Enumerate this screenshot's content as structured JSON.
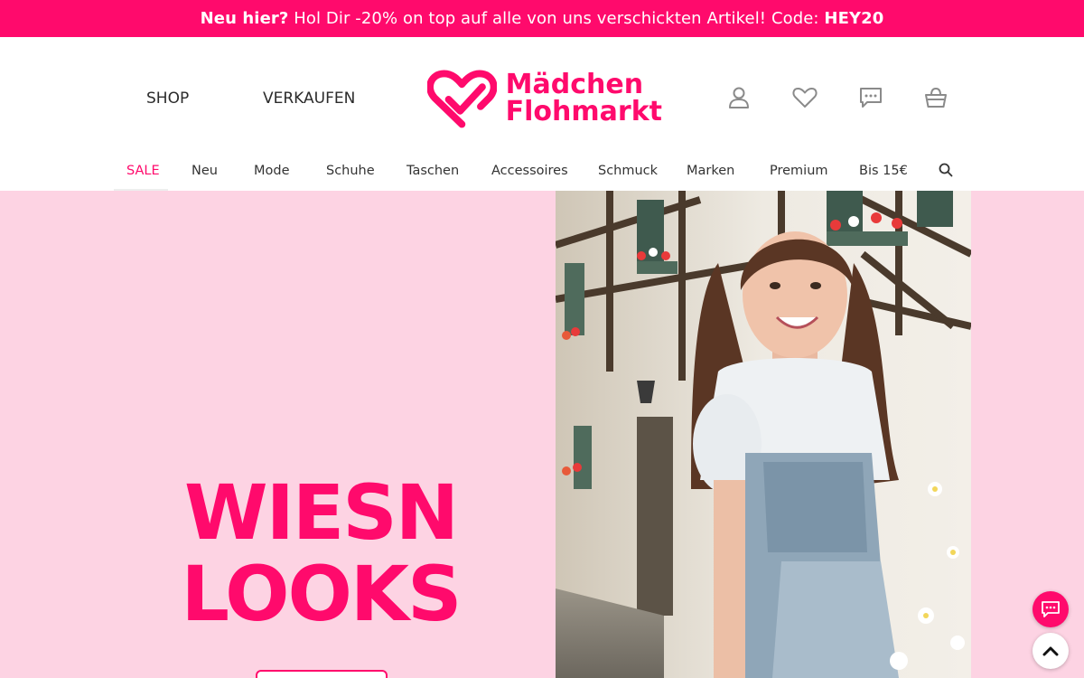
{
  "promo": {
    "lead": "Neu hier?",
    "text": " Hol Dir -20% on top auf alle von uns verschickten Artikel! Code: ",
    "code": "HEY20"
  },
  "header": {
    "nav": [
      {
        "label": "SHOP"
      },
      {
        "label": "VERKAUFEN"
      }
    ],
    "logo": {
      "line1": "Mädchen",
      "line2": "Flohmarkt"
    },
    "icons": [
      "user-icon",
      "heart-icon",
      "chat-icon",
      "basket-icon"
    ]
  },
  "categories": [
    {
      "label": "SALE"
    },
    {
      "label": "Neu"
    },
    {
      "label": "Mode"
    },
    {
      "label": "Schuhe"
    },
    {
      "label": "Taschen"
    },
    {
      "label": "Accessoires"
    },
    {
      "label": "Schmuck"
    },
    {
      "label": "Marken"
    },
    {
      "label": "Premium"
    },
    {
      "label": "Bis 15€"
    }
  ],
  "hero": {
    "title_line1": "WIESN",
    "title_line2": "LOOKS"
  },
  "colors": {
    "brand": "#ff0a6c",
    "hero_bg": "#fdd3e3"
  }
}
